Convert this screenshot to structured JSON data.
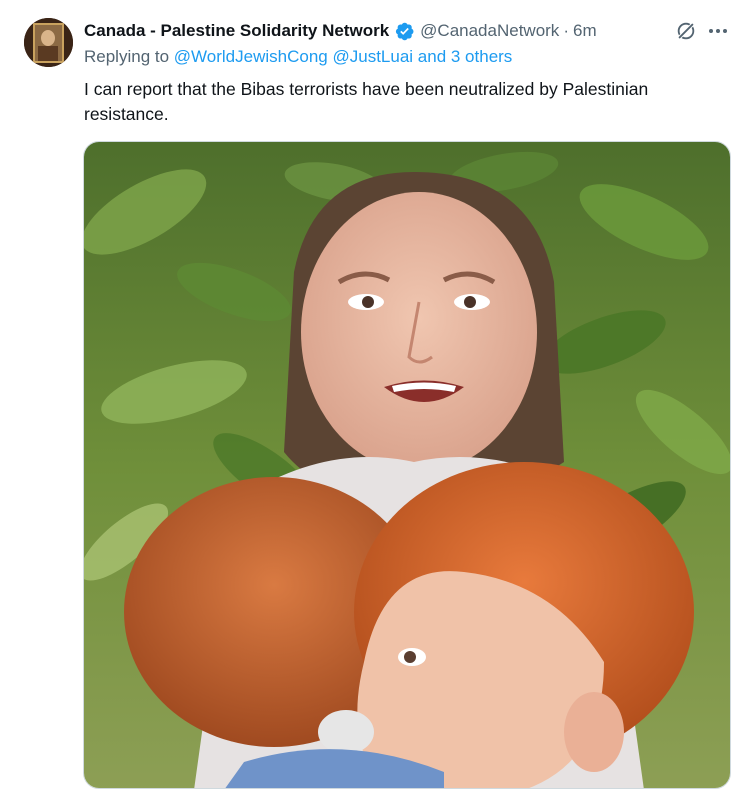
{
  "author": {
    "display_name": "Canada - Palestine Solidarity Network",
    "handle": "@CanadaNetwork",
    "separator": "·",
    "time": "6m",
    "verified": true,
    "verified_color": "#1d9bf0"
  },
  "replying": {
    "prefix": "Replying to",
    "mentions": [
      "@WorldJewishCong",
      "@JustLuai"
    ],
    "others": "and 3 others"
  },
  "text": "I can report that the Bibas terrorists have been neutralized by Palestinian resistance.",
  "icons": {
    "avatar": "avatar-image",
    "verified": "verified-badge-icon",
    "grok": "grok-icon",
    "more": "more-options-icon"
  },
  "colors": {
    "link": "#1d9bf0",
    "secondary_text": "#536471",
    "primary_text": "#0f1419",
    "border": "#cfd9de"
  }
}
